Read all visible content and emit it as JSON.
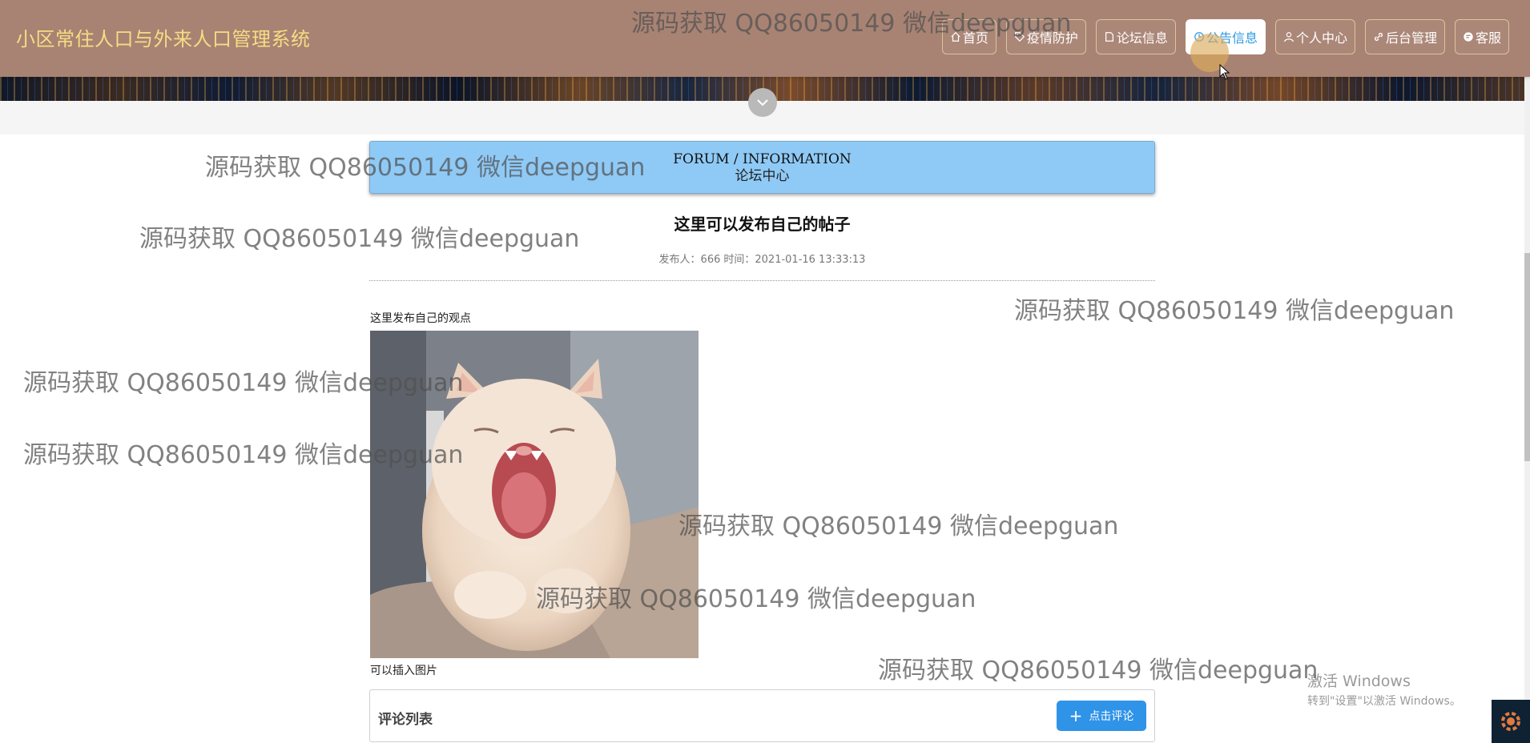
{
  "header": {
    "site_title": "小区常住人口与外来人口管理系统",
    "nav": [
      {
        "label": "首页",
        "icon": "home-icon"
      },
      {
        "label": "疫情防护",
        "icon": "tag-icon"
      },
      {
        "label": "论坛信息",
        "icon": "document-icon"
      },
      {
        "label": "公告信息",
        "icon": "clock-icon",
        "active": true
      },
      {
        "label": "个人中心",
        "icon": "user-icon"
      },
      {
        "label": "后台管理",
        "icon": "link-icon"
      },
      {
        "label": "客服",
        "icon": "chat-icon"
      }
    ]
  },
  "section": {
    "title_en": "FORUM / INFORMATION",
    "title_cn": "论坛中心"
  },
  "post": {
    "title": "这里可以发布自己的帖子",
    "publisher_label": "发布人：666",
    "time_label": "时间：2021-01-16 13:33:13",
    "text_before_image": "这里发布自己的观点",
    "image_icon": "yawning-cat-photo",
    "text_after_image": "可以插入图片"
  },
  "comments": {
    "title": "评论列表",
    "button_label": "点击评论"
  },
  "watermark_text": "源码获取 QQ86050149 微信deepguan",
  "os_overlay": {
    "line1": "激活 Windows",
    "line2": "转到\"设置\"以激活 Windows。"
  },
  "colors": {
    "header_bg": "#a88373",
    "title_color": "#f6dc83",
    "section_header_bg": "#8fcaf6",
    "accent_blue": "#2f93e8"
  }
}
